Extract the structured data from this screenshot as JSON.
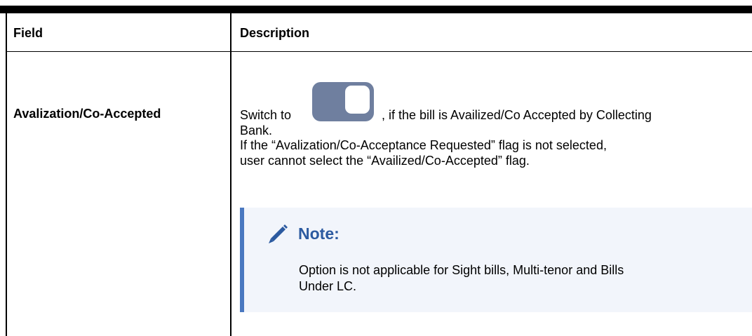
{
  "table": {
    "headers": {
      "field": "Field",
      "description": "Description"
    },
    "row": {
      "field": "Avalization/Co-Accepted",
      "desc_line1_before": "Switch to",
      "desc_line1_after": ", if the bill is Availized/Co Accepted by Collecting",
      "desc_line2": "Bank.",
      "desc_line3": "If the “Avalization/Co-Acceptance Requested” flag is not selected,",
      "desc_line4": "user cannot select the “Availized/Co-Accepted” flag."
    },
    "note": {
      "icon": "pencil-icon",
      "title": "Note:",
      "line1": "Option is not applicable for Sight bills, Multi-tenor and Bills",
      "line2": "Under LC."
    },
    "toggle": {
      "state": "on",
      "track_color": "#6f7f9f"
    }
  }
}
